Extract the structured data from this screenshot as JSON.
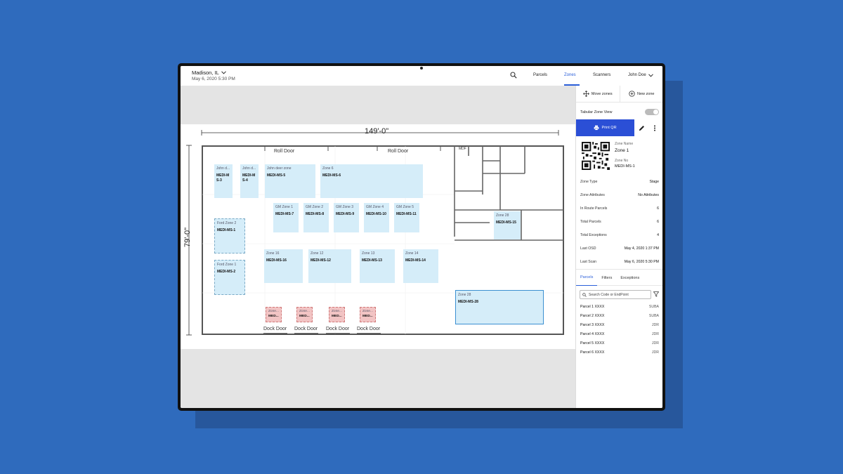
{
  "header": {
    "location": "Madison, IL",
    "datetime": "May 6, 2020 5:30 PM",
    "nav": [
      {
        "label": "Parcels"
      },
      {
        "label": "Zones"
      },
      {
        "label": "Scanners"
      }
    ],
    "active_nav": "Zones",
    "user": "John Doe"
  },
  "map": {
    "width_label": "149'-0\"",
    "height_label": "79'-0\"",
    "roll_door": "Roll Door",
    "dock_door": "Dock Door",
    "mdf": "MDF",
    "zones": [
      {
        "name": "John d...",
        "code": "MEDI-MS-3"
      },
      {
        "name": "John d...",
        "code": "MEDI-MS-4"
      },
      {
        "name": "John deer zone",
        "code": "MEDI-MS-5"
      },
      {
        "name": "Zone 6",
        "code": "MEDI-MS-6"
      },
      {
        "name": "GM Zone 1",
        "code": "MEDI-MS-7"
      },
      {
        "name": "GM Zone 2",
        "code": "MEDI-MS-8"
      },
      {
        "name": "GM Zone 3",
        "code": "MEDI-MS-9"
      },
      {
        "name": "GM Zone 4",
        "code": "MEDI-MS-10"
      },
      {
        "name": "GM Zone 5",
        "code": "MEDI-MS-11"
      },
      {
        "name": "Ford Zone 2",
        "code": "MEDI-MS-1"
      },
      {
        "name": "Ford Zone 1",
        "code": "MEDI-MS-2"
      },
      {
        "name": "Zone 16",
        "code": "MEDI-MS-16"
      },
      {
        "name": "Zone 12",
        "code": "MEDI-MS-12"
      },
      {
        "name": "Zone 13",
        "code": "MEDI-MS-13"
      },
      {
        "name": "Zone 14",
        "code": "MEDI-MS-14"
      },
      {
        "name": "Zone 28",
        "code": "MEDI-MS-15"
      },
      {
        "name": "Zone 28",
        "code": "MEDI-MS-28"
      },
      {
        "name": "Zone...",
        "code": "MED..."
      },
      {
        "name": "Zone...",
        "code": "MED..."
      },
      {
        "name": "Zone...",
        "code": "MED..."
      },
      {
        "name": "Zone...",
        "code": "MED..."
      }
    ]
  },
  "panel": {
    "move_zones": "Move zones",
    "new_zone": "New zone",
    "tabular_view": "Tabular Zone View",
    "print_qr": "Print QR",
    "zone_name_label": "Zone Name",
    "zone_name": "Zone 1",
    "zone_no_label": "Zone No",
    "zone_no": "MEDI-MS-1",
    "details": [
      {
        "k": "Zone Type",
        "v": "Stage"
      },
      {
        "k": "Zone Attributes",
        "v": "No Attributes"
      },
      {
        "k": "In Route Parcels",
        "v": "6"
      },
      {
        "k": "Total Parcels",
        "v": "6"
      },
      {
        "k": "Total Exceptions",
        "v": "4"
      },
      {
        "k": "Last OSD",
        "v": "May 4, 2020 1:37 PM"
      },
      {
        "k": "Last Scan",
        "v": "May 6, 2020 5:30 PM"
      }
    ],
    "tabs": [
      {
        "label": "Parcels"
      },
      {
        "label": "Filters"
      },
      {
        "label": "Exceptions"
      }
    ],
    "search_placeholder": "Search Code or EndPoint",
    "parcels": [
      {
        "name": "Parcel 1 XXXX",
        "code": "SUBA"
      },
      {
        "name": "Parcel 2 XXXX",
        "code": "SUBA"
      },
      {
        "name": "Parcel 3 XXXX",
        "code": "JDR"
      },
      {
        "name": "Parcel 4 XXXX",
        "code": "JDR"
      },
      {
        "name": "Parcel 5 XXXX",
        "code": "JDR"
      },
      {
        "name": "Parcel 6 XXXX",
        "code": "JDR"
      }
    ]
  },
  "colors": {
    "accent": "#2b4fd6",
    "zone_fill": "#d5edf9",
    "zone_alert": "#f2c4c4",
    "background": "#2f6bbd"
  }
}
